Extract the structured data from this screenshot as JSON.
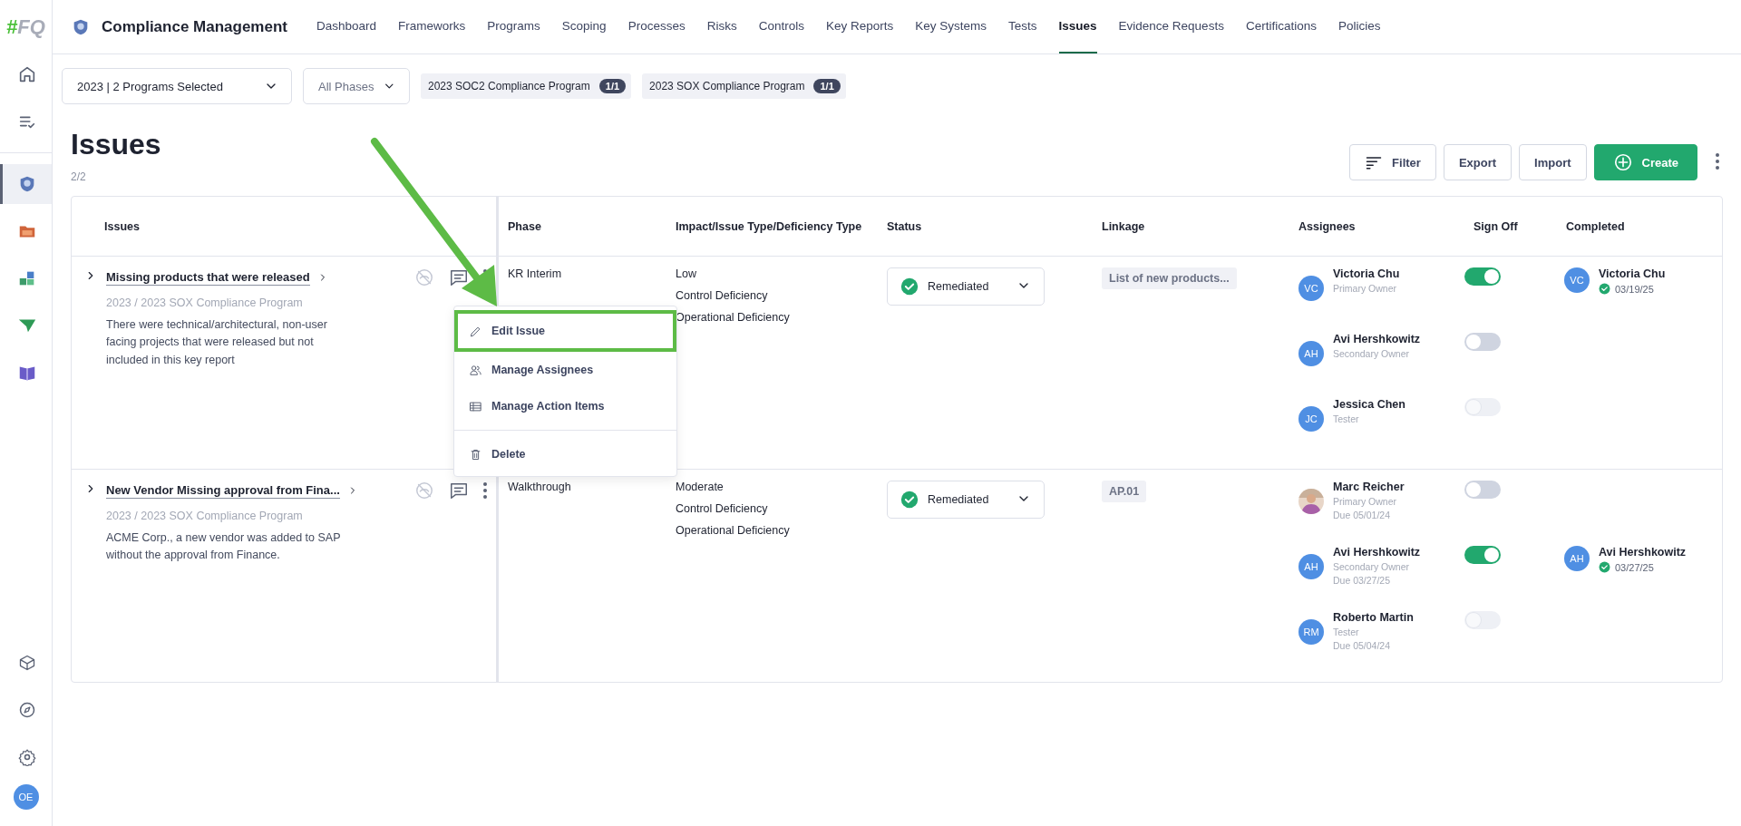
{
  "sidebar": {
    "logo": {
      "mark": "#",
      "text": "FQ"
    },
    "items": [
      {
        "selected": false
      },
      {
        "selected": false
      },
      {
        "selected": true
      },
      {
        "selected": false
      },
      {
        "selected": false
      },
      {
        "selected": false
      },
      {
        "selected": false
      }
    ],
    "user": "OE"
  },
  "app": {
    "title": "Compliance Management"
  },
  "nav_tabs": [
    {
      "label": "Dashboard",
      "selected": false
    },
    {
      "label": "Frameworks",
      "selected": false
    },
    {
      "label": "Programs",
      "selected": false
    },
    {
      "label": "Scoping",
      "selected": false
    },
    {
      "label": "Processes",
      "selected": false
    },
    {
      "label": "Risks",
      "selected": false
    },
    {
      "label": "Controls",
      "selected": false
    },
    {
      "label": "Key Reports",
      "selected": false
    },
    {
      "label": "Key Systems",
      "selected": false
    },
    {
      "label": "Tests",
      "selected": false
    },
    {
      "label": "Issues",
      "selected": true
    },
    {
      "label": "Evidence Requests",
      "selected": false
    },
    {
      "label": "Certifications",
      "selected": false
    },
    {
      "label": "Policies",
      "selected": false
    }
  ],
  "filters": {
    "program_select": "2023 | 2 Programs Selected",
    "phase_select": {
      "placeholder": "All Phases"
    },
    "chips": [
      {
        "label": "2023 SOC2 Compliance Program",
        "count": "1/1"
      },
      {
        "label": "2023 SOX Compliance Program",
        "count": "1/1"
      }
    ]
  },
  "page": {
    "title": "Issues",
    "count": "2/2"
  },
  "actions": [
    {
      "label": "Filter",
      "kind": "filter"
    },
    {
      "label": "Export",
      "kind": "plain"
    },
    {
      "label": "Import",
      "kind": "plain"
    },
    {
      "label": "Create",
      "kind": "primary"
    }
  ],
  "table": {
    "columns": [
      "Issues",
      "Phase",
      "Impact/Issue Type/Deficiency Type",
      "Status",
      "Linkage",
      "Assignees",
      "Sign Off",
      "Completed"
    ],
    "rows": [
      {
        "title": "Missing products that were released",
        "subtitle": "2023 / 2023 SOX Compliance Program",
        "description": "There were technical/architectural, non-user facing projects that were released but not included in this key report",
        "phase": "KR Interim",
        "impacts": [
          "Low",
          "Control Deficiency",
          "Operational Deficiency"
        ],
        "status": "Remediated",
        "linkage": "List of new products...",
        "assignees": [
          {
            "kind": "initials",
            "initials": "VC",
            "name": "Victoria Chu",
            "role": "Primary Owner",
            "signed_off": true,
            "disabled": false,
            "completion": {
              "initials": "VC",
              "name": "Victoria Chu",
              "date": "03/19/25"
            }
          },
          {
            "kind": "initials",
            "initials": "AH",
            "name": "Avi Hershkowitz",
            "role": "Secondary Owner",
            "signed_off": false,
            "disabled": false
          },
          {
            "kind": "initials",
            "initials": "JC",
            "name": "Jessica Chen",
            "role": "Tester",
            "signed_off": false,
            "disabled": true
          }
        ]
      },
      {
        "title": "New Vendor Missing approval from Fina...",
        "subtitle": "2023 / 2023 SOX Compliance Program",
        "description": "ACME Corp., a new vendor was added to SAP without the approval from Finance.",
        "phase": "Walkthrough",
        "impacts": [
          "Moderate",
          "Control Deficiency",
          "Operational Deficiency"
        ],
        "status": "Remediated",
        "linkage": "AP.01",
        "assignees": [
          {
            "name": "Marc Reicher",
            "role": "Primary Owner",
            "due": "Due 05/01/24",
            "signed_off": false,
            "disabled": false
          },
          {
            "kind": "initials",
            "initials": "AH",
            "name": "Avi Hershkowitz",
            "role": "Secondary Owner",
            "due": "Due 03/27/25",
            "signed_off": true,
            "disabled": false,
            "completion": {
              "initials": "AH",
              "name": "Avi Hershkowitz",
              "date": "03/27/25"
            }
          },
          {
            "kind": "initials",
            "initials": "RM",
            "name": "Roberto Martin",
            "role": "Tester",
            "due": "Due 05/04/24",
            "signed_off": false,
            "disabled": true
          }
        ]
      }
    ]
  },
  "context_menu": {
    "items": [
      {
        "label": "Edit Issue",
        "highlighted": true,
        "separated": false
      },
      {
        "label": "Manage Assignees",
        "highlighted": false,
        "separated": false
      },
      {
        "label": "Manage Action Items",
        "highlighted": false,
        "separated": false
      },
      {
        "label": "Delete",
        "highlighted": false,
        "separated": true
      }
    ]
  }
}
